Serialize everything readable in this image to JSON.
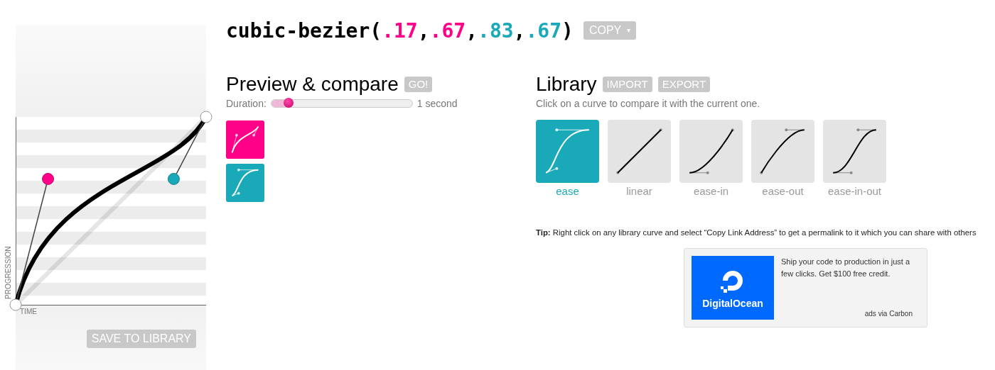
{
  "title": {
    "parts": [
      {
        "kind": "text",
        "text": "cubic-bezier(",
        "color": "#000000"
      },
      {
        "kind": "param",
        "text": ".17",
        "color": "#ff0088"
      },
      {
        "kind": "text",
        "text": ",",
        "color": "#000000"
      },
      {
        "kind": "param",
        "text": ".67",
        "color": "#ff0088"
      },
      {
        "kind": "text",
        "text": ",",
        "color": "#000000"
      },
      {
        "kind": "param",
        "text": ".83",
        "color": "#1aa9b8"
      },
      {
        "kind": "text",
        "text": ",",
        "color": "#000000"
      },
      {
        "kind": "param",
        "text": ".67",
        "color": "#1aa9b8"
      },
      {
        "kind": "text",
        "text": ")",
        "color": "#000000"
      }
    ],
    "copy_button": {
      "label": "COPY",
      "caret": "▾"
    }
  },
  "editor": {
    "y_axis_label": "PROGRESSION",
    "x_axis_label": "TIME",
    "save_button": "SAVE TO LIBRARY"
  },
  "preview": {
    "title": "Preview & compare",
    "go_button": "GO!",
    "duration_label": "Duration:",
    "duration": {
      "level": 0.12,
      "reading": "1 second"
    },
    "items": [
      {
        "kind": "current",
        "color": "#ff0088"
      },
      {
        "kind": "ease",
        "color": "#1aa9b8"
      }
    ]
  },
  "library": {
    "title": "Library",
    "buttons": [
      "IMPORT",
      "EXPORT"
    ],
    "hint": "Click on a curve to compare it with the current one.",
    "curves": [
      {
        "kind": "ease",
        "label": "ease",
        "selected": true
      },
      {
        "kind": "linear",
        "label": "linear",
        "selected": false
      },
      {
        "kind": "ease-in",
        "label": "ease-in",
        "selected": false
      },
      {
        "kind": "ease-out",
        "label": "ease-out",
        "selected": false
      },
      {
        "kind": "ease-in-out",
        "label": "ease-in-out",
        "selected": false
      }
    ]
  },
  "tip": "**Tip:** Right click on any library curve and select “Copy Link Address” to get a permalink to it which you can share with others",
  "ad": {
    "brand": "DigitalOcean",
    "text": "Ship your code to production in just a few clicks. Get $100 free credit.",
    "credit": "ads via Carbon"
  }
}
